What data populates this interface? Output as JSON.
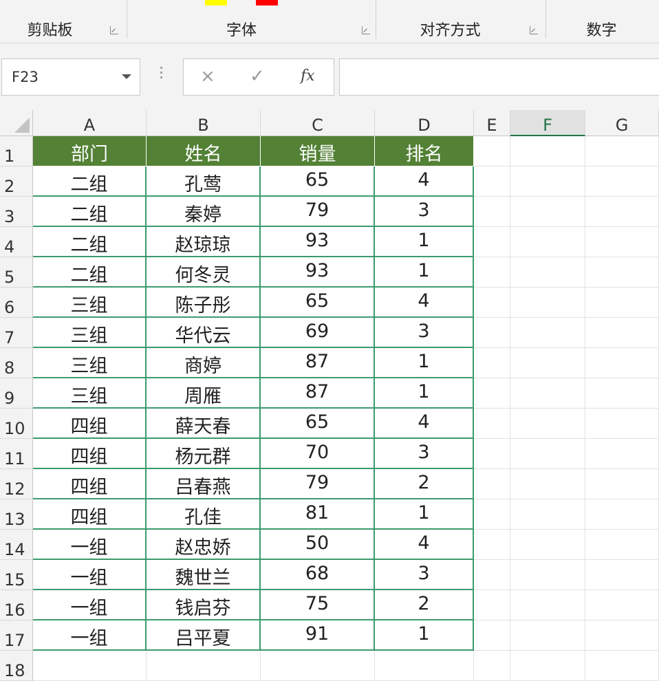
{
  "ribbon": {
    "groups": [
      {
        "label": "剪贴板"
      },
      {
        "label": "字体"
      },
      {
        "label": "对齐方式"
      },
      {
        "label": "数字"
      }
    ],
    "font_color": "#ffff00",
    "fill_color": "#ff0000"
  },
  "formula_bar": {
    "name_box": "F23",
    "cancel_icon": "×",
    "enter_icon": "✓",
    "fx_label": "fx",
    "formula": ""
  },
  "sheet": {
    "columns": [
      "A",
      "B",
      "C",
      "D",
      "E",
      "F",
      "G"
    ],
    "selected_column": "F",
    "rows": [
      "1",
      "2",
      "3",
      "4",
      "5",
      "6",
      "7",
      "8",
      "9",
      "10",
      "11",
      "12",
      "13",
      "14",
      "15",
      "16",
      "17",
      "18"
    ],
    "header": [
      "部门",
      "姓名",
      "销量",
      "排名"
    ],
    "header_color": "#538135",
    "data": [
      [
        "二组",
        "孔莺",
        "65",
        "4"
      ],
      [
        "二组",
        "秦婷",
        "79",
        "3"
      ],
      [
        "二组",
        "赵琼琼",
        "93",
        "1"
      ],
      [
        "二组",
        "何冬灵",
        "93",
        "1"
      ],
      [
        "三组",
        "陈子彤",
        "65",
        "4"
      ],
      [
        "三组",
        "华代云",
        "69",
        "3"
      ],
      [
        "三组",
        "商婷",
        "87",
        "1"
      ],
      [
        "三组",
        "周雁",
        "87",
        "1"
      ],
      [
        "四组",
        "薛天春",
        "65",
        "4"
      ],
      [
        "四组",
        "杨元群",
        "70",
        "3"
      ],
      [
        "四组",
        "吕春燕",
        "79",
        "2"
      ],
      [
        "四组",
        "孔佳",
        "81",
        "1"
      ],
      [
        "一组",
        "赵忠娇",
        "50",
        "4"
      ],
      [
        "一组",
        "魏世兰",
        "68",
        "3"
      ],
      [
        "一组",
        "钱启芬",
        "75",
        "2"
      ],
      [
        "一组",
        "吕平夏",
        "91",
        "1"
      ]
    ]
  }
}
